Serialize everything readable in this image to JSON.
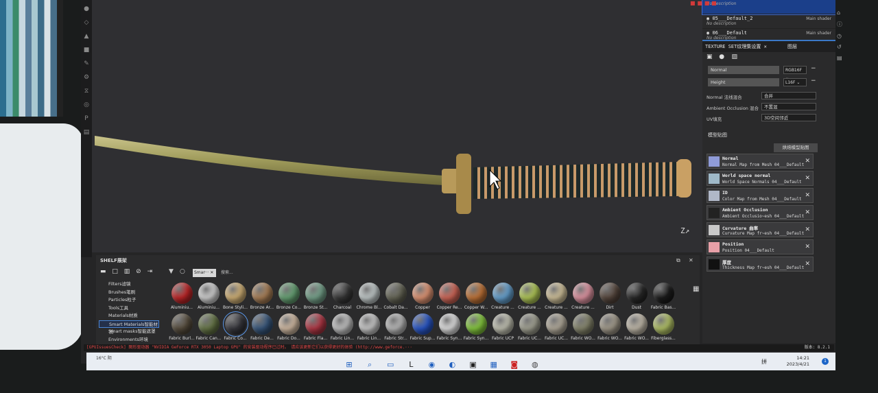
{
  "layers": [
    {
      "name": "",
      "desc": "No description",
      "shader": "",
      "selected": true
    },
    {
      "name": "05___Default_2",
      "desc": "No description",
      "shader": "Main shader",
      "selected": false
    },
    {
      "name": "06___Default",
      "desc": "No description",
      "shader": "Main shader",
      "selected": false
    }
  ],
  "panel_tabs": {
    "tab1": "TEXTURE SET纹理集设置",
    "tab1_close": "✕",
    "tab2": "图层"
  },
  "channels": [
    {
      "name": "Normal",
      "format": "RGB16F"
    },
    {
      "name": "Height",
      "format": "L16F"
    }
  ],
  "settings": [
    {
      "label": "Normal 法线混合",
      "value": "合并"
    },
    {
      "label": "Ambient Occlusion 混合",
      "value": "不置混"
    },
    {
      "label": "UV填充",
      "value": "3D空间邻近"
    }
  ],
  "bake": {
    "heading": "模型贴图",
    "button": "烘焙模型贴图"
  },
  "maps": [
    {
      "title": "Normal",
      "sub": "Normal Map from Mesh 04___Default",
      "color": "#8f9bd8"
    },
    {
      "title": "World space normal",
      "sub": "World Space Normals 04___Default",
      "color": "#9fb9c8"
    },
    {
      "title": "ID",
      "sub": "Color Map from Mesh 04___Default",
      "color": "#b0b8c8"
    },
    {
      "title": "Ambient Occlusion",
      "sub": "Ambient Occlusio~esh 04___Default",
      "color": "#222222"
    },
    {
      "title": "Curvature 曲率",
      "sub": "Curvature Map fr~esh 04___Default",
      "color": "#c8c8c8"
    },
    {
      "title": "Position",
      "sub": "Position 04___Default",
      "color": "#e8a0a8"
    },
    {
      "title": "厚度",
      "sub": "Thickness Map fr~esh 04___Default",
      "color": "#111111"
    }
  ],
  "shelf": {
    "title": "SHELF展架",
    "search_placeholder": "搜索...",
    "search_tag": "Smar··· ✕",
    "categories": [
      {
        "label": "Filters滤镜",
        "selected": false
      },
      {
        "label": "Brushes笔刷",
        "selected": false
      },
      {
        "label": "Particles粒子",
        "selected": false
      },
      {
        "label": "Tools工具",
        "selected": false
      },
      {
        "label": "Materials材质",
        "selected": false
      },
      {
        "label": "Smart Materials智能材质",
        "selected": true
      },
      {
        "label": "Smart masks智能遮罩",
        "selected": false
      },
      {
        "label": "Environments环境",
        "selected": false
      }
    ],
    "materials_row1": [
      {
        "name": "Aluminiu...",
        "color": "#c8282a"
      },
      {
        "name": "Aluminiu...",
        "color": "#d8d8d8"
      },
      {
        "name": "Bone Styli...",
        "color": "#d8b77a"
      },
      {
        "name": "Bronze Ar...",
        "color": "#b0845a"
      },
      {
        "name": "Bronze Co...",
        "color": "#6aa878"
      },
      {
        "name": "Bronze St...",
        "color": "#7aa890"
      },
      {
        "name": "Charcoal",
        "color": "#3a3a3a"
      },
      {
        "name": "Chrome Bl...",
        "color": "#c8d0d0"
      },
      {
        "name": "Cobalt Da...",
        "color": "#6a6a5a"
      },
      {
        "name": "Copper",
        "color": "#e89a78"
      },
      {
        "name": "Copper Re...",
        "color": "#d86a5a"
      },
      {
        "name": "Copper W...",
        "color": "#c8783a"
      },
      {
        "name": "Creature ...",
        "color": "#6aa8d8"
      },
      {
        "name": "Creature ...",
        "color": "#b8d05a"
      },
      {
        "name": "Creature ...",
        "color": "#d8c8a0"
      },
      {
        "name": "Creature ...",
        "color": "#e89aa8"
      },
      {
        "name": "Dirt",
        "color": "#5a4a40"
      },
      {
        "name": "Dust",
        "color": "#2a2a2a"
      },
      {
        "name": "Fabric Bas...",
        "color": "#1e1e1e"
      }
    ],
    "materials_row2": [
      {
        "name": "Fabric Burl...",
        "color": "#5a5040",
        "selected": false
      },
      {
        "name": "Fabric Can...",
        "color": "#6a7a4a",
        "selected": false
      },
      {
        "name": "Fabric Co...",
        "color": "#3a3a40",
        "selected": true
      },
      {
        "name": "Fabric De...",
        "color": "#3a5a80",
        "selected": false
      },
      {
        "name": "Fabric Do...",
        "color": "#d8c0a8",
        "selected": false
      },
      {
        "name": "Fabric Fla...",
        "color": "#b83a48",
        "selected": false
      },
      {
        "name": "Fabric Lin...",
        "color": "#c8c8c8",
        "selected": false
      },
      {
        "name": "Fabric Lin...",
        "color": "#d0d0d0",
        "selected": false
      },
      {
        "name": "Fabric Str...",
        "color": "#c0c0c0",
        "selected": false
      },
      {
        "name": "Fabric Sup...",
        "color": "#2a5ad0",
        "selected": false
      },
      {
        "name": "Fabric Syn...",
        "color": "#e8e8e8",
        "selected": false
      },
      {
        "name": "Fabric Syn...",
        "color": "#8ad040",
        "selected": false
      },
      {
        "name": "Fabric UCP",
        "color": "#c8c8b8",
        "selected": false
      },
      {
        "name": "Fabric UC...",
        "color": "#a8a898",
        "selected": false
      },
      {
        "name": "Fabric UC...",
        "color": "#b8b0a0",
        "selected": false
      },
      {
        "name": "Fabric WO...",
        "color": "#8a8a70",
        "selected": false
      },
      {
        "name": "Fabric WO...",
        "color": "#a8a090",
        "selected": false
      },
      {
        "name": "Fabric WO...",
        "color": "#c8c0b0",
        "selected": false
      },
      {
        "name": "Fiberglass...",
        "color": "#b8c86a",
        "selected": false
      }
    ]
  },
  "console": {
    "text": "[GPUIssuesCheck] 图形驱动器 \"NVIDIA GeForce RTX 3050 Laptop GPU\" 的安装驱动程序已过时。 请应该更新它们以获得更好的体验  (http://www.geforce.···",
    "right": "版本: 8.2.1"
  },
  "taskbar": {
    "weather": "16°C 阴",
    "time": "14:21",
    "date": "2023/4/21",
    "ime": "拼",
    "notifications": "1"
  },
  "gizmo": "Z",
  "colors": {
    "accent": "#3b78c8",
    "selected_layer": "#1b3f8a",
    "warning": "#e04646"
  }
}
